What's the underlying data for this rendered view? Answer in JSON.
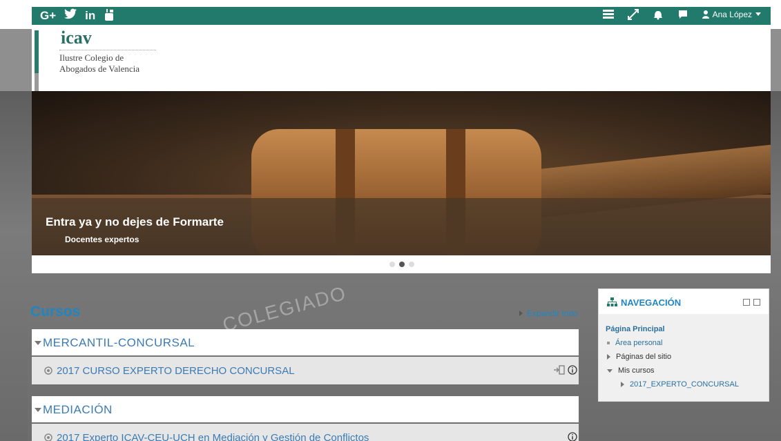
{
  "topbar": {
    "social": [
      "G+",
      "twitter",
      "in",
      "youtube"
    ],
    "user_name": "Ana López",
    "icons": [
      "menu-icon",
      "fullscreen-icon",
      "bell-icon",
      "chat-icon",
      "user-icon"
    ],
    "accent": "#227a6c"
  },
  "header": {
    "logo_word": "icav",
    "logo_line1": "Ilustre Colegio de",
    "logo_line2": "Abogados de Valencia"
  },
  "slider": {
    "caption_title": "Entra ya y no dejes de Formarte",
    "caption_sub": "Docentes expertos",
    "dots": 3,
    "active_dot": 1
  },
  "main": {
    "title": "Cursos",
    "expand_all": "Expandir todo",
    "watermark": "COLEGIADO",
    "categories": [
      {
        "name": "MERCANTIL-CONCURSAL",
        "courses": [
          {
            "name": "2017 CURSO EXPERTO DERECHO CONCURSAL"
          }
        ]
      },
      {
        "name": "MEDIACIÓN",
        "courses": [
          {
            "name": "2017 Experto ICAV-CEU-UCH en Mediación y Gestión de Conflictos"
          }
        ]
      }
    ]
  },
  "navigation": {
    "title": "NAVEGACIÓN",
    "main": "Página Principal",
    "items": [
      "Área personal",
      "Páginas del sitio",
      "Mis cursos"
    ],
    "sub_items": [
      "2017_EXPERTO_CONCURSAL"
    ]
  },
  "colors": {
    "link": "#1f86c2",
    "category_text": "#3b7bb2"
  }
}
